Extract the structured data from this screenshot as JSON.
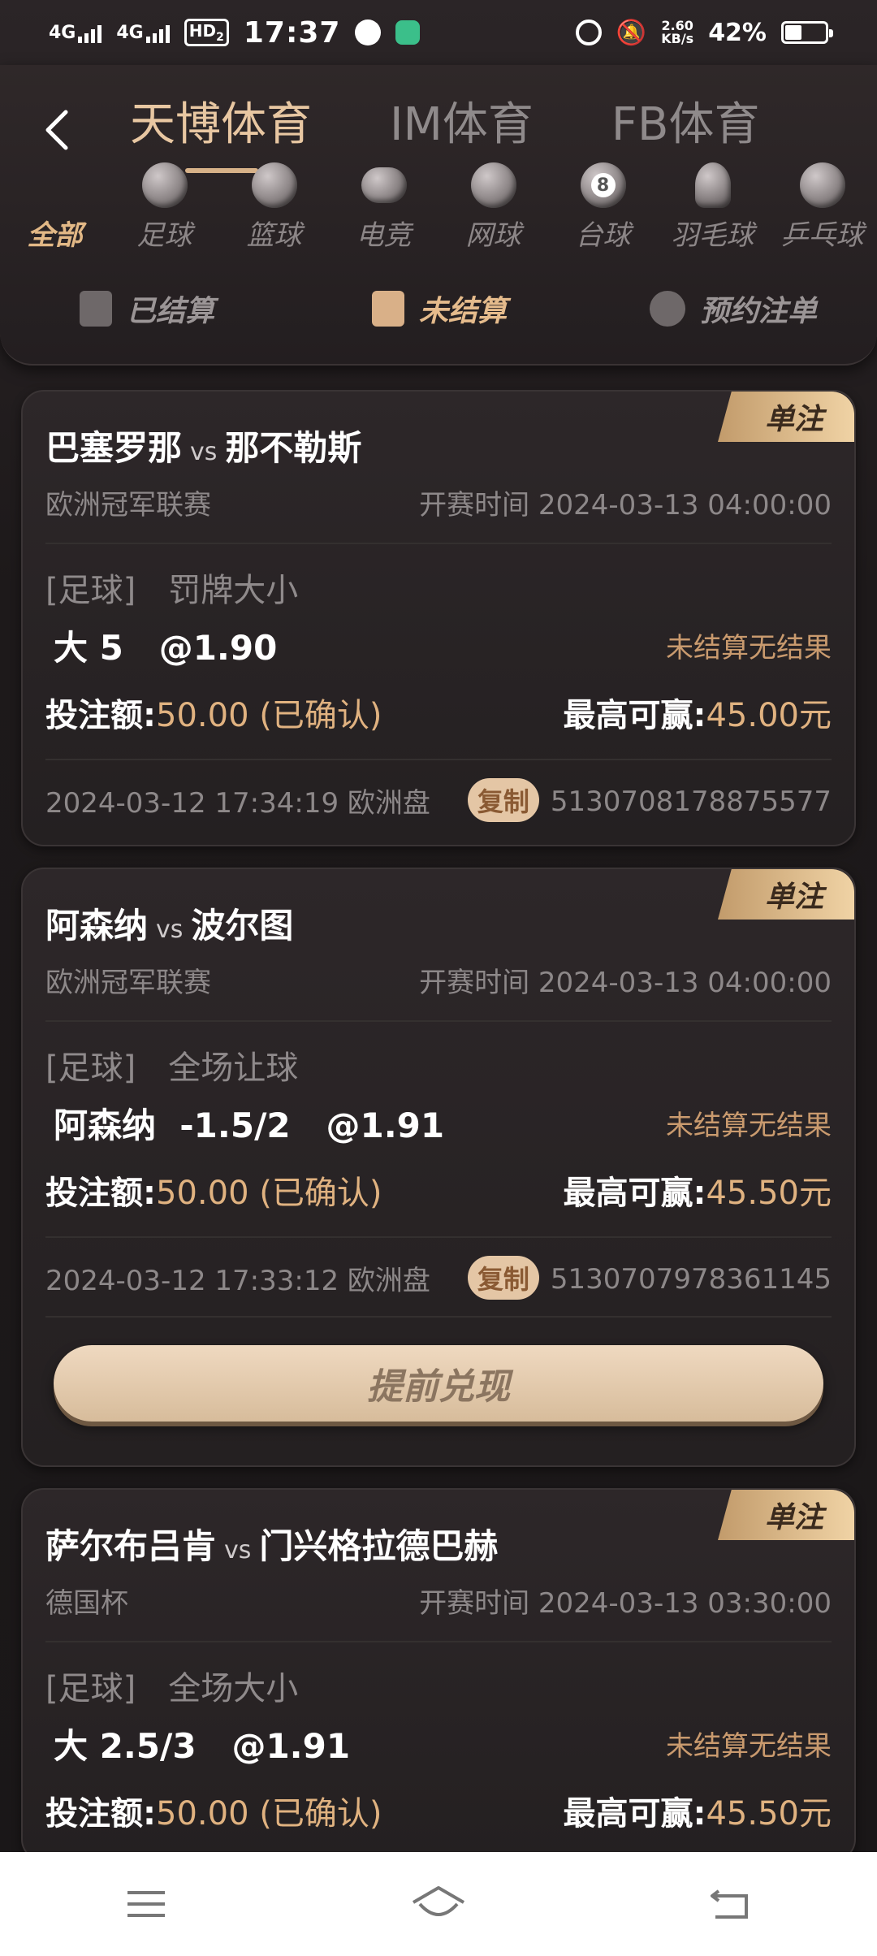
{
  "status_bar": {
    "net1": "4G",
    "net2": "4G",
    "hd": "HD",
    "hd_sub": "2",
    "time": "17:37",
    "speed_value": "2.60",
    "speed_unit": "KB/s",
    "battery": "42%"
  },
  "header": {
    "tabs": [
      {
        "label": "天博体育",
        "active": true
      },
      {
        "label": "IM体育",
        "active": false
      },
      {
        "label": "FB体育",
        "active": false
      }
    ],
    "sports": [
      {
        "label": "全部",
        "icon": "all-grid-icon",
        "active": true
      },
      {
        "label": "足球",
        "icon": "football-icon"
      },
      {
        "label": "篮球",
        "icon": "basketball-icon"
      },
      {
        "label": "电竞",
        "icon": "gamepad-icon"
      },
      {
        "label": "网球",
        "icon": "tennis-icon"
      },
      {
        "label": "台球",
        "icon": "billiards-icon",
        "glyph": "8"
      },
      {
        "label": "羽毛球",
        "icon": "badminton-icon"
      },
      {
        "label": "乒乓球",
        "icon": "pingpong-icon"
      }
    ],
    "subtabs": [
      {
        "label": "已结算",
        "icon": "settled-icon"
      },
      {
        "label": "未结算",
        "icon": "unsettled-icon",
        "active": true
      },
      {
        "label": "预约注单",
        "icon": "clock-icon"
      }
    ]
  },
  "bets": [
    {
      "badge": "单注",
      "home": "巴塞罗那",
      "vs": "vs",
      "away": "那不勒斯",
      "league": "欧洲冠军联赛",
      "start_label": "开赛时间",
      "start_time": "2024-03-13 04:00:00",
      "sport": "[足球]",
      "market": "罚牌大小",
      "pick": "大 5   @1.90",
      "status": "未结算无结果",
      "stake_label": "投注额:",
      "stake": "50.00 (已确认)",
      "win_label": "最高可赢:",
      "win": "45.00元",
      "placed": "2024-03-12 17:34:19 欧洲盘",
      "copy": "复制",
      "order_id": "5130708178875577"
    },
    {
      "badge": "单注",
      "home": "阿森纳",
      "vs": "vs",
      "away": "波尔图",
      "league": "欧洲冠军联赛",
      "start_label": "开赛时间",
      "start_time": "2024-03-13 04:00:00",
      "sport": "[足球]",
      "market": "全场让球",
      "pick": "阿森纳  -1.5/2   @1.91",
      "status": "未结算无结果",
      "stake_label": "投注额:",
      "stake": "50.00 (已确认)",
      "win_label": "最高可赢:",
      "win": "45.50元",
      "placed": "2024-03-12 17:33:12 欧洲盘",
      "copy": "复制",
      "order_id": "5130707978361145",
      "cashout": "提前兑现"
    },
    {
      "badge": "单注",
      "home": "萨尔布吕肯",
      "vs": "vs",
      "away": "门兴格拉德巴赫",
      "league": "德国杯",
      "start_label": "开赛时间",
      "start_time": "2024-03-13 03:30:00",
      "sport": "[足球]",
      "market": "全场大小",
      "pick": "大 2.5/3   @1.91",
      "status": "未结算无结果",
      "stake_label": "投注额:",
      "stake": "50.00 (已确认)",
      "win_label": "最高可赢:",
      "win": "45.50元"
    }
  ],
  "colors": {
    "accent": "#e0b280",
    "background": "#1a1718",
    "card": "#2a2526",
    "badge": "#e6c495"
  }
}
